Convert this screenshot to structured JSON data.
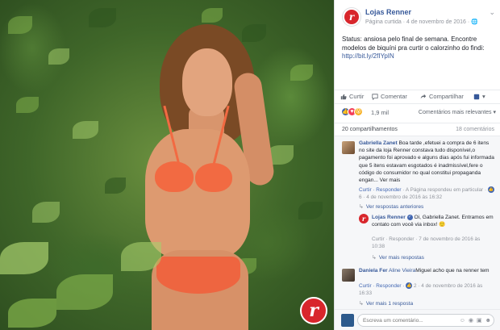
{
  "post": {
    "page_name": "Lojas Renner",
    "meta": "Página curtida · 4 de novembro de 2016 · ",
    "text": "Status: ansiosa pelo final de semana. Encontre modelos de biquíni pra curtir o calorzinho do findi:",
    "link": "http://bit.ly/2fIYpIN",
    "brand_letter": "r"
  },
  "actions": {
    "like": "Curtir",
    "comment": "Comentar",
    "share": "Compartilhar"
  },
  "reactions": {
    "count": "1,9 mil",
    "relevance": "Comentários mais relevantes ▾"
  },
  "stats": {
    "shares": "20 compartilhamentos",
    "comments": "18 comentários"
  },
  "comments": [
    {
      "author": "Gabriella Zanet",
      "text": "Boa tarde ,efetuei a compra de 6 itens no site da loja Renner constava tudo disponível,o pagamento foi aprovado e alguns dias após fui informada que 5 itens estavam esgotados é inadmissível,fere o código do consumidor no qual constitui propaganda engan... Ver mais",
      "meta_reply": "Curtir · Responder",
      "meta_rest": " · A Página respondeu em particular · ",
      "likes": "6",
      "time": " · 4 de novembro de 2016 às 16:32",
      "prev_replies": "Ver respostas anteriores",
      "reply": {
        "author": "Lojas Renner",
        "text": "Oi, Gabriella Zanet. Entramos em contato com você via inbox! 🙂",
        "meta": "Curtir · Responder · 7 de novembro de 2016 às 10:38"
      },
      "more_replies": "Ver mais respostas"
    },
    {
      "author": "Daniela Fer",
      "tag": "Aline Vieira",
      "text": "Miguel acho que na renner tem",
      "meta_reply": "Curtir · Responder · ",
      "likes": "2",
      "time": " · 4 de novembro de 2016 às 16:33",
      "more_replies": "Ver mais 1 resposta"
    }
  ],
  "composer": {
    "placeholder": "Escreva um comentário..."
  },
  "colors": {
    "brand_red": "#d8262c",
    "fb_blue": "#4267b2",
    "link_blue": "#365899",
    "bikini": "#f26a42"
  }
}
